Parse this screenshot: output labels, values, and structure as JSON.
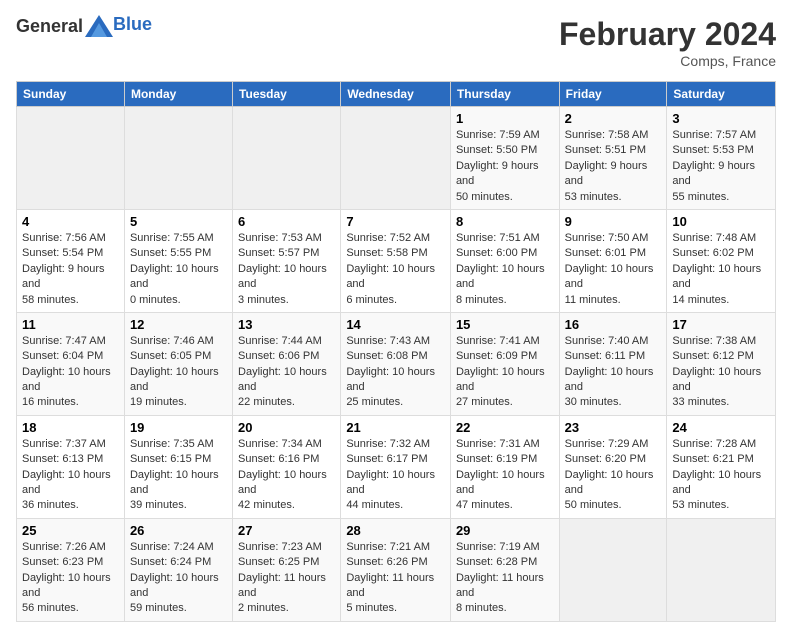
{
  "header": {
    "logo_general": "General",
    "logo_blue": "Blue",
    "title": "February 2024",
    "subtitle": "Comps, France"
  },
  "calendar": {
    "days_of_week": [
      "Sunday",
      "Monday",
      "Tuesday",
      "Wednesday",
      "Thursday",
      "Friday",
      "Saturday"
    ],
    "weeks": [
      [
        {
          "day": "",
          "info": ""
        },
        {
          "day": "",
          "info": ""
        },
        {
          "day": "",
          "info": ""
        },
        {
          "day": "",
          "info": ""
        },
        {
          "day": "1",
          "info": "Sunrise: 7:59 AM\nSunset: 5:50 PM\nDaylight: 9 hours and 50 minutes."
        },
        {
          "day": "2",
          "info": "Sunrise: 7:58 AM\nSunset: 5:51 PM\nDaylight: 9 hours and 53 minutes."
        },
        {
          "day": "3",
          "info": "Sunrise: 7:57 AM\nSunset: 5:53 PM\nDaylight: 9 hours and 55 minutes."
        }
      ],
      [
        {
          "day": "4",
          "info": "Sunrise: 7:56 AM\nSunset: 5:54 PM\nDaylight: 9 hours and 58 minutes."
        },
        {
          "day": "5",
          "info": "Sunrise: 7:55 AM\nSunset: 5:55 PM\nDaylight: 10 hours and 0 minutes."
        },
        {
          "day": "6",
          "info": "Sunrise: 7:53 AM\nSunset: 5:57 PM\nDaylight: 10 hours and 3 minutes."
        },
        {
          "day": "7",
          "info": "Sunrise: 7:52 AM\nSunset: 5:58 PM\nDaylight: 10 hours and 6 minutes."
        },
        {
          "day": "8",
          "info": "Sunrise: 7:51 AM\nSunset: 6:00 PM\nDaylight: 10 hours and 8 minutes."
        },
        {
          "day": "9",
          "info": "Sunrise: 7:50 AM\nSunset: 6:01 PM\nDaylight: 10 hours and 11 minutes."
        },
        {
          "day": "10",
          "info": "Sunrise: 7:48 AM\nSunset: 6:02 PM\nDaylight: 10 hours and 14 minutes."
        }
      ],
      [
        {
          "day": "11",
          "info": "Sunrise: 7:47 AM\nSunset: 6:04 PM\nDaylight: 10 hours and 16 minutes."
        },
        {
          "day": "12",
          "info": "Sunrise: 7:46 AM\nSunset: 6:05 PM\nDaylight: 10 hours and 19 minutes."
        },
        {
          "day": "13",
          "info": "Sunrise: 7:44 AM\nSunset: 6:06 PM\nDaylight: 10 hours and 22 minutes."
        },
        {
          "day": "14",
          "info": "Sunrise: 7:43 AM\nSunset: 6:08 PM\nDaylight: 10 hours and 25 minutes."
        },
        {
          "day": "15",
          "info": "Sunrise: 7:41 AM\nSunset: 6:09 PM\nDaylight: 10 hours and 27 minutes."
        },
        {
          "day": "16",
          "info": "Sunrise: 7:40 AM\nSunset: 6:11 PM\nDaylight: 10 hours and 30 minutes."
        },
        {
          "day": "17",
          "info": "Sunrise: 7:38 AM\nSunset: 6:12 PM\nDaylight: 10 hours and 33 minutes."
        }
      ],
      [
        {
          "day": "18",
          "info": "Sunrise: 7:37 AM\nSunset: 6:13 PM\nDaylight: 10 hours and 36 minutes."
        },
        {
          "day": "19",
          "info": "Sunrise: 7:35 AM\nSunset: 6:15 PM\nDaylight: 10 hours and 39 minutes."
        },
        {
          "day": "20",
          "info": "Sunrise: 7:34 AM\nSunset: 6:16 PM\nDaylight: 10 hours and 42 minutes."
        },
        {
          "day": "21",
          "info": "Sunrise: 7:32 AM\nSunset: 6:17 PM\nDaylight: 10 hours and 44 minutes."
        },
        {
          "day": "22",
          "info": "Sunrise: 7:31 AM\nSunset: 6:19 PM\nDaylight: 10 hours and 47 minutes."
        },
        {
          "day": "23",
          "info": "Sunrise: 7:29 AM\nSunset: 6:20 PM\nDaylight: 10 hours and 50 minutes."
        },
        {
          "day": "24",
          "info": "Sunrise: 7:28 AM\nSunset: 6:21 PM\nDaylight: 10 hours and 53 minutes."
        }
      ],
      [
        {
          "day": "25",
          "info": "Sunrise: 7:26 AM\nSunset: 6:23 PM\nDaylight: 10 hours and 56 minutes."
        },
        {
          "day": "26",
          "info": "Sunrise: 7:24 AM\nSunset: 6:24 PM\nDaylight: 10 hours and 59 minutes."
        },
        {
          "day": "27",
          "info": "Sunrise: 7:23 AM\nSunset: 6:25 PM\nDaylight: 11 hours and 2 minutes."
        },
        {
          "day": "28",
          "info": "Sunrise: 7:21 AM\nSunset: 6:26 PM\nDaylight: 11 hours and 5 minutes."
        },
        {
          "day": "29",
          "info": "Sunrise: 7:19 AM\nSunset: 6:28 PM\nDaylight: 11 hours and 8 minutes."
        },
        {
          "day": "",
          "info": ""
        },
        {
          "day": "",
          "info": ""
        }
      ]
    ]
  }
}
